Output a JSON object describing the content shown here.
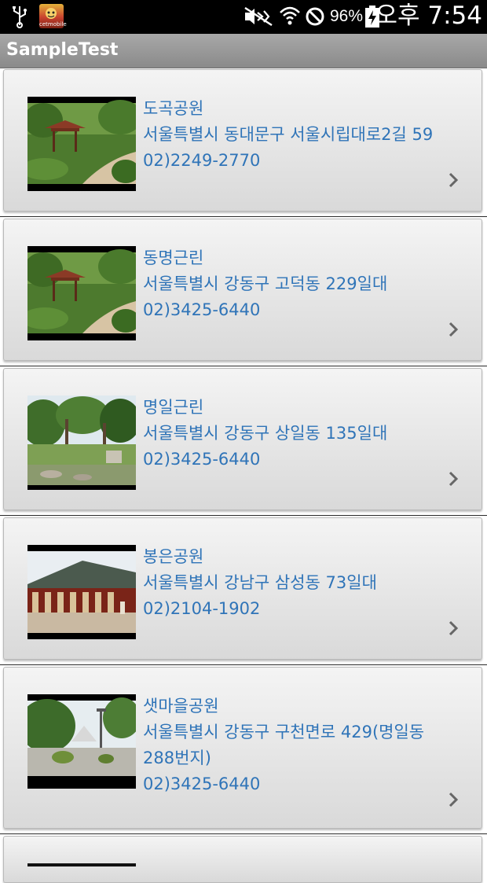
{
  "status_bar": {
    "battery": "96%",
    "time": "오후 7:54",
    "app_icon_label": "cetmobile",
    "icons": [
      "usb-icon",
      "app-notification-icon",
      "mute-icon",
      "wifi-icon",
      "blocked-icon",
      "battery-charging-icon"
    ]
  },
  "action_bar": {
    "title": "SampleTest"
  },
  "list": {
    "items": [
      {
        "name": "도곡공원",
        "address": "서울특별시 동대문구 서울시립대로2길 59",
        "address2": "",
        "phone": "02)2249-2770",
        "thumb": "pavilion"
      },
      {
        "name": "동명근린",
        "address": "서울특별시 강동구 고덕동 229일대",
        "address2": "",
        "phone": "02)3425-6440",
        "thumb": "pavilion"
      },
      {
        "name": "명일근린",
        "address": "서울특별시 강동구 상일동 135일대",
        "address2": "",
        "phone": "02)3425-6440",
        "thumb": "forest"
      },
      {
        "name": "봉은공원",
        "address": "서울특별시 강남구 삼성동 73일대",
        "address2": "",
        "phone": "02)2104-1902",
        "thumb": "temple"
      },
      {
        "name": "샛마을공원",
        "address": "서울특별시 강동구 구천면로 429(명일동",
        "address2": "288번지)",
        "phone": "02)3425-6440",
        "thumb": "plaza"
      }
    ]
  },
  "colors": {
    "link_text": "#2f74b8",
    "action_bar": "#999999",
    "status_bar": "#000000"
  }
}
